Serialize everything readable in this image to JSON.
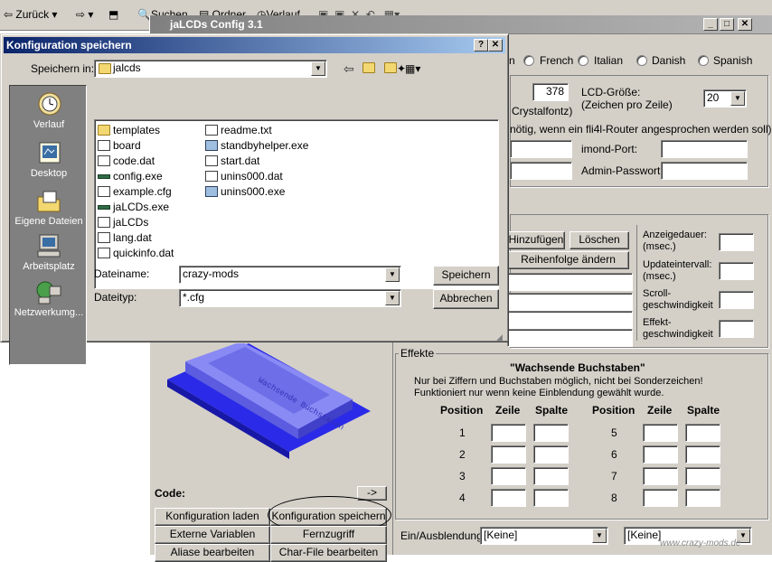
{
  "explorer": {
    "back": "Zurück",
    "search": "Suchen",
    "folders": "Ordner",
    "history": "Verlauf"
  },
  "app": {
    "title": "jaLCDs Config 3.1",
    "languages": [
      "n",
      "French",
      "Italian",
      "Danish",
      "Spanish"
    ],
    "crystal_value": "378",
    "crystal_label": "Crystalfontz)",
    "lcd_size_label": "LCD-Größe:",
    "lcd_size_sub": "(Zeichen pro Zeile)",
    "lcd_size_value": "20",
    "router_note": "nötig, wenn ein fli4l-Router angesprochen werden soll)",
    "imond_port": "imond-Port:",
    "admin_pw": "Admin-Passwort:",
    "add": "Hinzufügen",
    "delete": "Löschen",
    "reorder": "Reihenfolge ändern",
    "display_duration": "Anzeigedauer:",
    "display_duration_unit": "(msec.)",
    "update_interval": "Updateintervall:",
    "update_interval_unit": "(msec.)",
    "scroll_speed": "Scroll-",
    "scroll_speed2": "geschwindigkeit",
    "effect_speed": "Effekt-",
    "effect_speed2": "geschwindigkeit",
    "effects_title": "Effekte",
    "effect_name": "\"Wachsende Buchstaben\"",
    "effect_note1": "Nur bei Ziffern und Buchstaben möglich, nicht bei Sonderzeichen!",
    "effect_note2": "Funktioniert nur wenn keine Einblendung gewählt wurde.",
    "col_position": "Position",
    "col_row": "Zeile",
    "col_column": "Spalte",
    "positions_left": [
      "1",
      "2",
      "3",
      "4"
    ],
    "positions_right": [
      "5",
      "6",
      "7",
      "8"
    ],
    "code_label": "Code:",
    "arrow_btn": "->",
    "load_config": "Konfiguration laden",
    "save_config": "Konfiguration speichern",
    "ext_vars": "Externe Variablen",
    "remote": "Fernzugriff",
    "aliases": "Aliase bearbeiten",
    "charfile": "Char-File bearbeiten",
    "fade_label": "Ein/Ausblendung:",
    "fade_value1": "[Keine]",
    "fade_value2": "[Keine]",
    "lcd_text": "Wachsende Buchstaben"
  },
  "dialog": {
    "title": "Konfiguration speichern",
    "save_in_label": "Speichern in:",
    "save_in_value": "jalcds",
    "places": [
      "Verlauf",
      "Desktop",
      "Eigene Dateien",
      "Arbeitsplatz",
      "Netzwerkumg..."
    ],
    "files_col1": [
      {
        "name": "templates",
        "type": "folder"
      },
      {
        "name": "board",
        "type": "doc"
      },
      {
        "name": "code.dat",
        "type": "doc"
      },
      {
        "name": "config.exe",
        "type": "exe"
      },
      {
        "name": "example.cfg",
        "type": "doc"
      },
      {
        "name": "jaLCDs.exe",
        "type": "exe"
      },
      {
        "name": "jaLCDs",
        "type": "doc"
      },
      {
        "name": "lang.dat",
        "type": "doc"
      },
      {
        "name": "quickinfo.dat",
        "type": "doc"
      }
    ],
    "files_col2": [
      {
        "name": "readme.txt",
        "type": "doc"
      },
      {
        "name": "standbyhelper.exe",
        "type": "gear"
      },
      {
        "name": "start.dat",
        "type": "doc"
      },
      {
        "name": "unins000.dat",
        "type": "doc"
      },
      {
        "name": "unins000.exe",
        "type": "gear"
      }
    ],
    "filename_label": "Dateiname:",
    "filename_value": "crazy-mods",
    "filetype_label": "Dateityp:",
    "filetype_value": "*.cfg",
    "save_button": "Speichern",
    "cancel_button": "Abbrechen"
  },
  "watermark": "www.crazy-mods.de"
}
